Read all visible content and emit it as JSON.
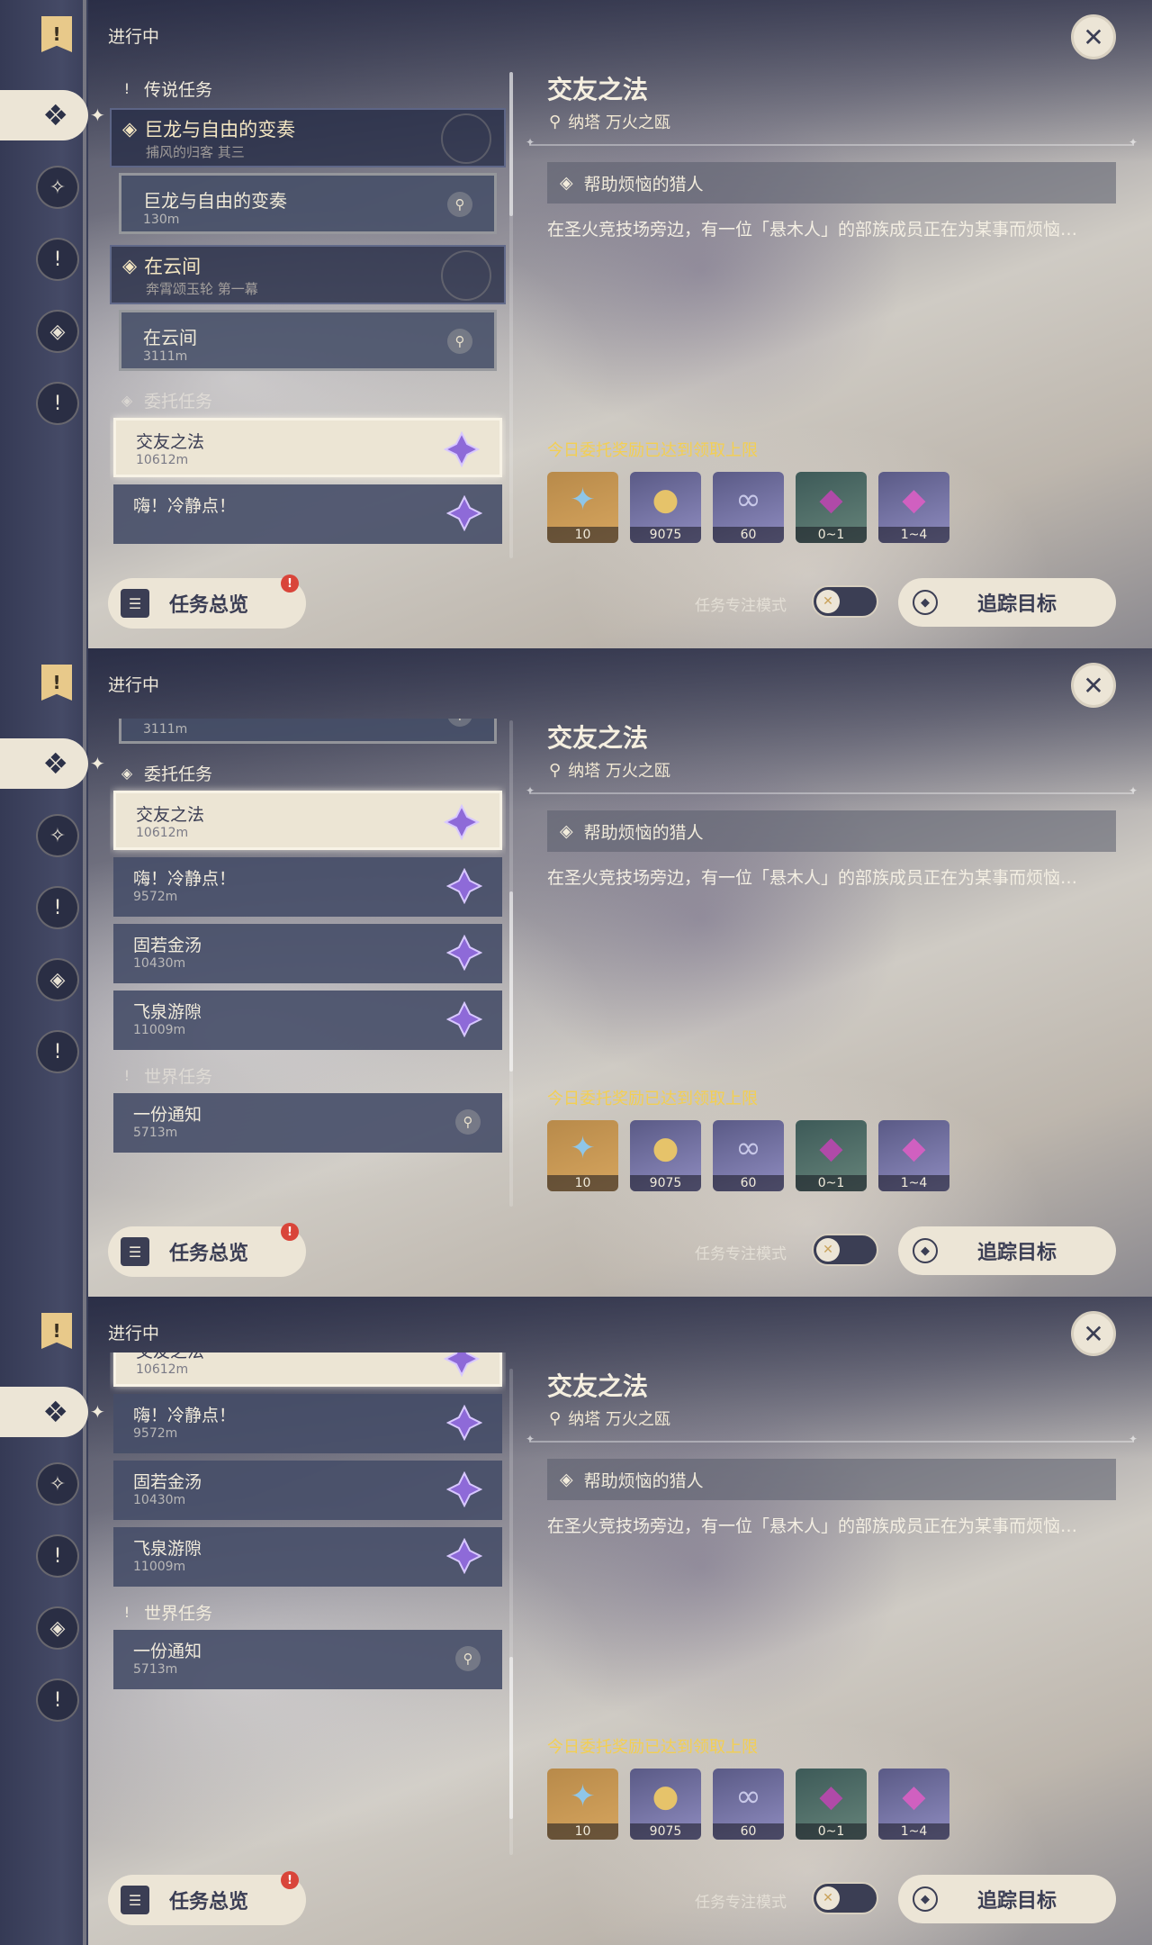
{
  "header": {
    "in_progress": "进行中"
  },
  "sections": {
    "legend": "传说任务",
    "commission": "委托任务",
    "world": "世界任务"
  },
  "story_quests": [
    {
      "title": "巨龙与自由的变奏",
      "subtitle": "捕风的归客 其三",
      "sub_title": "巨龙与自由的变奏",
      "sub_dist": "130m"
    },
    {
      "title": "在云间",
      "subtitle": "奔霄颂玉轮 第一幕",
      "sub_title": "在云间",
      "sub_dist": "3111m"
    }
  ],
  "commissions": [
    {
      "title": "交友之法",
      "dist": "10612m"
    },
    {
      "title": "嗨！冷静点！",
      "dist": "9572m"
    },
    {
      "title": "固若金汤",
      "dist": "10430m"
    },
    {
      "title": "飞泉游隙",
      "dist": "11009m"
    }
  ],
  "world_quests": [
    {
      "title": "一份通知",
      "dist": "5713m"
    }
  ],
  "overview": {
    "label": "任务总览",
    "badge": "!"
  },
  "detail": {
    "title": "交友之法",
    "location": "纳塔 万火之瓯",
    "step": "帮助烦恼的猎人",
    "description": "在圣火竞技场旁边，有一位「悬木人」的部族成员正在为某事而烦恼…",
    "reward_note": "今日委托奖励已达到领取上限",
    "rewards": [
      {
        "icon": "adventure-exp-icon",
        "qty": "10"
      },
      {
        "icon": "mora-icon",
        "qty": "9075"
      },
      {
        "icon": "friendship-exp-icon",
        "qty": "60"
      },
      {
        "icon": "crystal-icon",
        "qty": "0~1"
      },
      {
        "icon": "mystic-crystal-icon",
        "qty": "1~4"
      }
    ],
    "focus_mode": "任务专注模式",
    "track": "追踪目标"
  },
  "colors": {
    "accent": "#ece5d6",
    "highlight": "#f3cf52",
    "commission_star": "#8e6ad8"
  }
}
